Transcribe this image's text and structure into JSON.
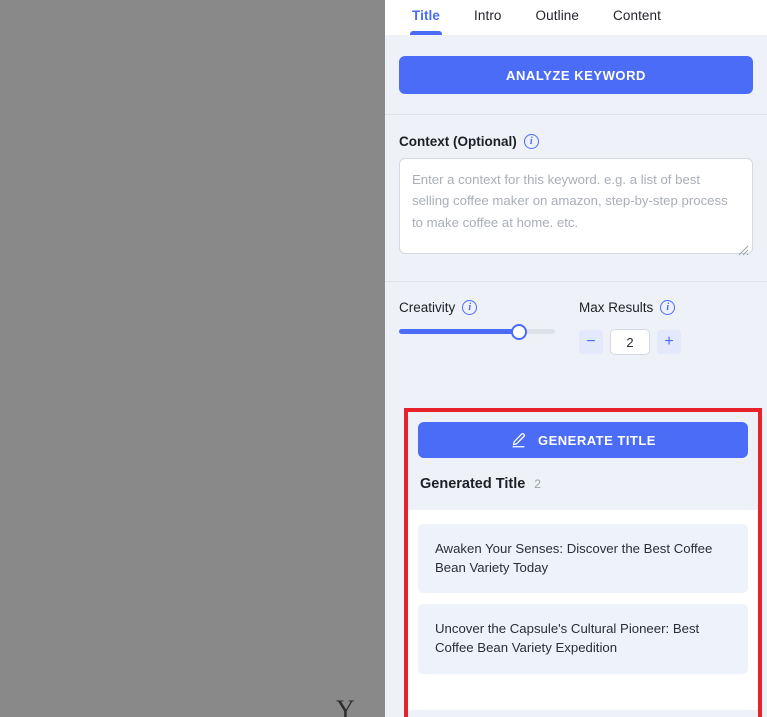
{
  "tabs": [
    {
      "label": "Title",
      "active": true
    },
    {
      "label": "Intro",
      "active": false
    },
    {
      "label": "Outline",
      "active": false
    },
    {
      "label": "Content",
      "active": false
    }
  ],
  "analyze": {
    "button_label": "ANALYZE KEYWORD"
  },
  "context": {
    "label": "Context (Optional)",
    "info_glyph": "i",
    "value": "",
    "placeholder": "Enter a context for this keyword. e.g. a list of best selling coffee maker on amazon, step-by-step process to make coffee at home. etc."
  },
  "creativity": {
    "label": "Creativity",
    "info_glyph": "i",
    "percent": 77
  },
  "max_results": {
    "label": "Max Results",
    "info_glyph": "i",
    "value": "2",
    "decrement_label": "−",
    "increment_label": "+"
  },
  "generate": {
    "button_label": "GENERATE TITLE",
    "icon": "pencil-icon"
  },
  "generated": {
    "heading": "Generated Title",
    "count": "2",
    "items": [
      "Awaken Your Senses: Discover the Best Coffee Bean Variety Today",
      "Uncover the Capsule's Cultural Pioneer: Best Coffee Bean Variety Expedition"
    ]
  },
  "left_region": {
    "partial_glyph": "Y"
  },
  "colors": {
    "accent": "#4a6cf7",
    "highlight_border": "#e8222a",
    "panel_bg": "#eef1f8",
    "card_bg": "#eef2fa",
    "dim_overlay": "#898989"
  }
}
